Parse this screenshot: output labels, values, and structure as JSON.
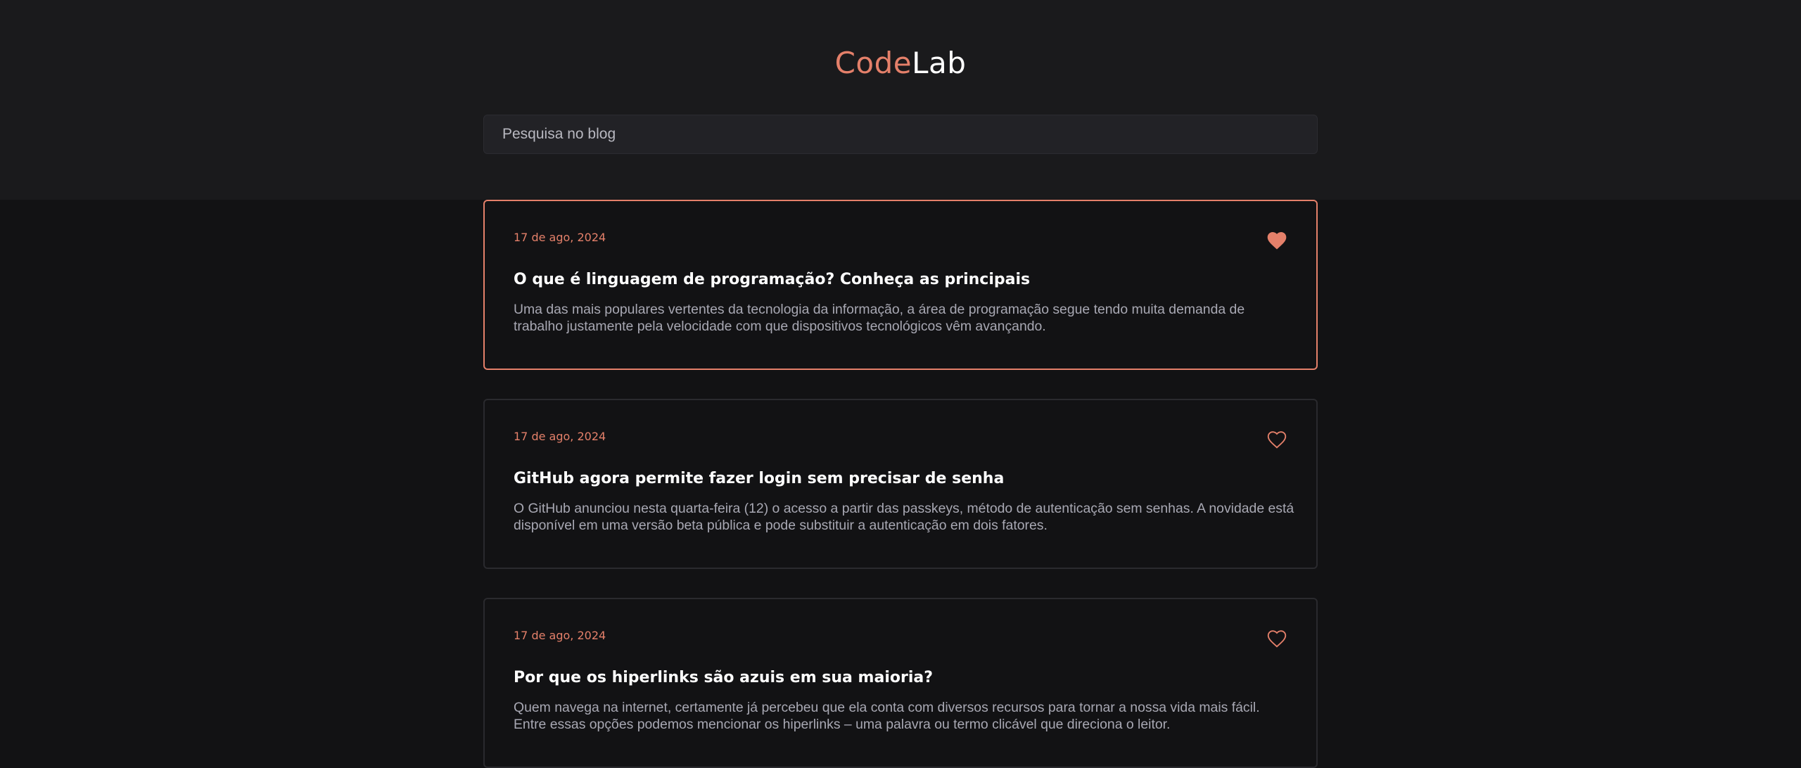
{
  "header": {
    "logo_part1": "Code",
    "logo_part2": "Lab"
  },
  "search": {
    "placeholder": "Pesquisa no blog",
    "value": ""
  },
  "colors": {
    "accent": "#e4806a",
    "background": "#121214",
    "header_background": "#1a1a1c",
    "card_border": "#2a2a2e"
  },
  "posts": [
    {
      "date": "17 de ago, 2024",
      "title": "O que é linguagem de programação? Conheça as principais",
      "excerpt": "Uma das mais populares vertentes da tecnologia da informação, a área de programação segue tendo muita demanda de trabalho justamente pela velocidade com que dispositivos tecnológicos vêm avançando.",
      "liked": true,
      "icon": "heart-filled-icon"
    },
    {
      "date": "17 de ago, 2024",
      "title": "GitHub agora permite fazer login sem precisar de senha",
      "excerpt": "O GitHub anunciou nesta quarta-feira (12) o acesso a partir das passkeys, método de autenticação sem senhas. A novidade está disponível em uma versão beta pública e pode substituir a autenticação em dois fatores.",
      "liked": false,
      "icon": "heart-outline-icon"
    },
    {
      "date": "17 de ago, 2024",
      "title": "Por que os hiperlinks são azuis em sua maioria?",
      "excerpt": "Quem navega na internet, certamente já percebeu que ela conta com diversos recursos para tornar a nossa vida mais fácil. Entre essas opções podemos mencionar os hiperlinks – uma palavra ou termo clicável que direciona o leitor.",
      "liked": false,
      "icon": "heart-outline-icon"
    }
  ]
}
